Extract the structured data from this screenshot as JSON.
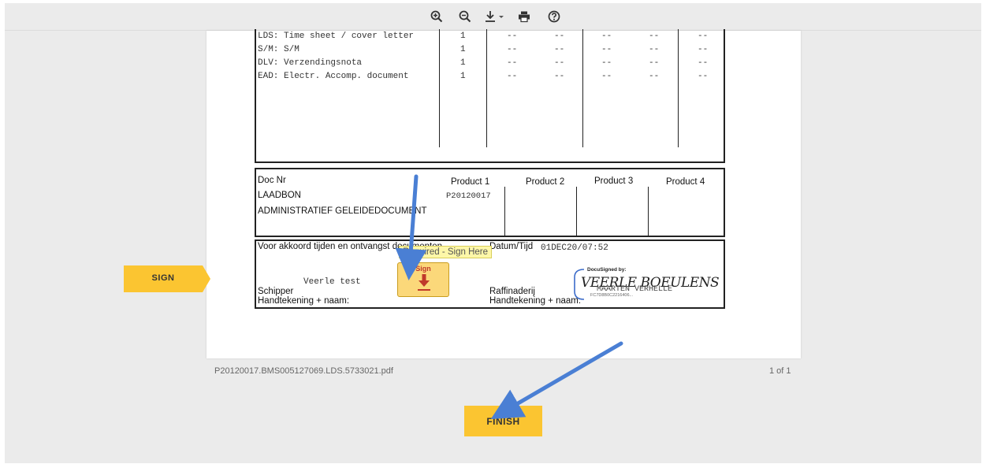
{
  "toolbar": {
    "zoom_in": "zoom-in-icon",
    "zoom_out": "zoom-out-icon",
    "download": "download-icon",
    "print": "print-icon",
    "help": "help-icon"
  },
  "document": {
    "rows": [
      {
        "label": "LDS: Time sheet / cover letter",
        "qty": "1",
        "dashes": [
          "--",
          "--",
          "--",
          "--",
          "--"
        ]
      },
      {
        "label": "S/M: S/M",
        "qty": "1",
        "dashes": [
          "--",
          "--",
          "--",
          "--",
          "--"
        ]
      },
      {
        "label": "DLV: Verzendingsnota",
        "qty": "1",
        "dashes": [
          "--",
          "--",
          "--",
          "--",
          "--"
        ]
      },
      {
        "label": "EAD: Electr. Accomp. document",
        "qty": "1",
        "dashes": [
          "--",
          "--",
          "--",
          "--",
          "--"
        ]
      }
    ],
    "doc_nr_label": "Doc Nr",
    "products": [
      "Product 1",
      "Product 2",
      "Product 3",
      "Product 4"
    ],
    "laadbon": "LAADBON",
    "admin_doc": "ADMINISTRATIEF GELEIDEDOCUMENT",
    "product1_value": "P20120017",
    "akkoord_text": "Voor akkoord tijden en ontvangst documenten",
    "datum_label": "Datum/Tijd",
    "datum_value": "01DEC20/07:52",
    "schipper_name": "Veerle test",
    "schipper_label": "Schipper",
    "handtekening_left": "Handtekening + naam:",
    "raffinaderij": "Raffinaderij",
    "handtekening_right": "Handtekening + naam:",
    "docusigned_by": "DocuSigned by:",
    "signature_script": "VEERLE BOEULENS",
    "signer_name": "MAARTEN VERHELLE",
    "sig_id": "FC7D8B0C2216406..."
  },
  "tooltip": "Required - Sign Here",
  "sign_field_label": "Sign",
  "sign_tab_label": "SIGN",
  "filename": "P20120017.BMS005127069.LDS.5733021.pdf",
  "page_count": "1 of 1",
  "finish_label": "FINISH",
  "colors": {
    "accent": "#fbc531",
    "arrow": "#4a7fd4",
    "toolbar_bg": "#ebebeb"
  }
}
